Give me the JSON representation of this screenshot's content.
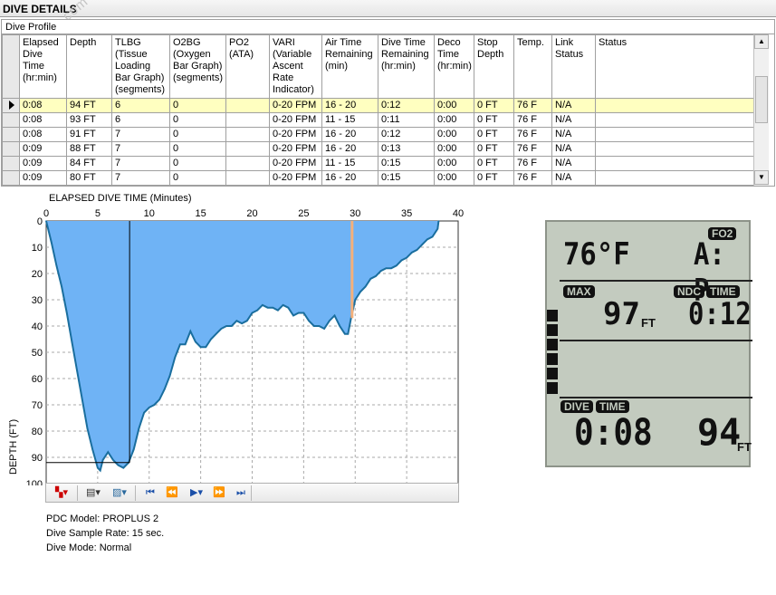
{
  "window": {
    "title": "DIVE DETAILS",
    "watermark": "www.ives.com"
  },
  "profile": {
    "label": "Dive Profile",
    "columns": [
      "Elapsed Dive Time (hr:min)",
      "Depth",
      "TLBG (Tissue Loading Bar Graph) (segments)",
      "O2BG (Oxygen Bar Graph) (segments)",
      "PO2 (ATA)",
      "VARI (Variable Ascent Rate Indicator)",
      "Air Time Remaining (min)",
      "Dive Time Remaining (hr:min)",
      "Deco Time (hr:min)",
      "Stop Depth",
      "Temp.",
      "Link Status",
      "Status"
    ],
    "rows": [
      [
        "0:08",
        "94 FT",
        "6",
        "0",
        "",
        "0-20 FPM",
        "16 - 20",
        "0:12",
        "0:00",
        "0 FT",
        "76 F",
        "N/A",
        ""
      ],
      [
        "0:08",
        "93 FT",
        "6",
        "0",
        "",
        "0-20 FPM",
        "11 - 15",
        "0:11",
        "0:00",
        "0 FT",
        "76 F",
        "N/A",
        ""
      ],
      [
        "0:08",
        "91 FT",
        "7",
        "0",
        "",
        "0-20 FPM",
        "16 - 20",
        "0:12",
        "0:00",
        "0 FT",
        "76 F",
        "N/A",
        ""
      ],
      [
        "0:09",
        "88 FT",
        "7",
        "0",
        "",
        "0-20 FPM",
        "16 - 20",
        "0:13",
        "0:00",
        "0 FT",
        "76 F",
        "N/A",
        ""
      ],
      [
        "0:09",
        "84 FT",
        "7",
        "0",
        "",
        "0-20 FPM",
        "11 - 15",
        "0:15",
        "0:00",
        "0 FT",
        "76 F",
        "N/A",
        ""
      ],
      [
        "0:09",
        "80 FT",
        "7",
        "0",
        "",
        "0-20 FPM",
        "16 - 20",
        "0:15",
        "0:00",
        "0 FT",
        "76 F",
        "N/A",
        ""
      ]
    ],
    "selected_row": 0
  },
  "chart_data": {
    "type": "area",
    "title": "ELAPSED DIVE TIME (Minutes)",
    "xlabel": "ELAPSED DIVE TIME (Minutes)",
    "ylabel": "DEPTH (FT)",
    "xlim": [
      0,
      40
    ],
    "ylim": [
      0,
      100
    ],
    "y_inverted": true,
    "x_ticks": [
      0,
      5,
      10,
      15,
      20,
      25,
      30,
      35,
      40
    ],
    "y_ticks": [
      0,
      10,
      20,
      30,
      40,
      50,
      60,
      70,
      80,
      90,
      100
    ],
    "fill_color": "#6fb3f5",
    "line_color": "#1a6e9e",
    "cursor_line_x": 8.1,
    "cursor_line_depth": 92,
    "marker_line": {
      "x": 29.7,
      "from_depth": 0,
      "to_depth": 37,
      "color": "#f4b07a"
    },
    "series": [
      {
        "x": [
          0,
          0.5,
          1,
          1.5,
          2,
          2.5,
          3,
          3.5,
          4,
          4.5,
          5,
          5.25,
          5.5,
          6,
          6.5,
          7,
          7.5,
          8,
          8.5,
          9,
          9.5,
          10,
          10.5,
          11,
          11.5,
          12,
          12.5,
          13,
          13.5,
          14,
          14.5,
          15,
          15.5,
          16,
          16.5,
          17,
          17.5,
          18,
          18.5,
          19,
          19.5,
          20,
          20.5,
          21,
          21.5,
          22,
          22.5,
          23,
          23.5,
          24,
          24.5,
          25,
          25.5,
          26,
          26.5,
          27,
          27.5,
          28,
          28.5,
          29,
          29.3,
          29.6,
          30,
          30.5,
          31,
          31.5,
          32,
          32.5,
          33,
          33.5,
          34,
          34.5,
          35,
          35.5,
          36,
          36.5,
          37,
          37.5,
          38,
          38.1
        ],
        "y": [
          0,
          8,
          17,
          25,
          35,
          46,
          57,
          68,
          79,
          87,
          94,
          95,
          91,
          88,
          91,
          93,
          94,
          92,
          87,
          79,
          73,
          71,
          70,
          68,
          64,
          59,
          52,
          47,
          47,
          42,
          46,
          48,
          48,
          45,
          43,
          41,
          40,
          40,
          38,
          39,
          38,
          35,
          34,
          32,
          33,
          33,
          34,
          32,
          33,
          36,
          35,
          35,
          38,
          40,
          40,
          41,
          38,
          36,
          40,
          43,
          43,
          37,
          30,
          27,
          25,
          22,
          21,
          19,
          18,
          18,
          17,
          15,
          14,
          12,
          11,
          9,
          7,
          6,
          3,
          0
        ]
      }
    ]
  },
  "toolbar": {
    "items": [
      "palette-dropdown",
      "print-dropdown",
      "image-dropdown",
      "first",
      "previous",
      "play",
      "next",
      "last"
    ]
  },
  "info": {
    "model": "PDC Model: PROPLUS 2",
    "sample_rate": "Dive Sample Rate: 15 sec.",
    "mode": "Dive Mode: Normal"
  },
  "lcd": {
    "fo2_tag": "FO2",
    "temp": "76°F",
    "fo2_value": "A: P",
    "max_tag": "MAX",
    "max_depth": "97",
    "ndc_tag": "NDC",
    "time_tag": "TIME",
    "ndc_time": "0:12",
    "dive_tag": "DIVE",
    "dive_time_tag": "TIME",
    "dive_time": "0:08",
    "depth": "94",
    "unit": "FT",
    "tlbg_segments": 6
  }
}
